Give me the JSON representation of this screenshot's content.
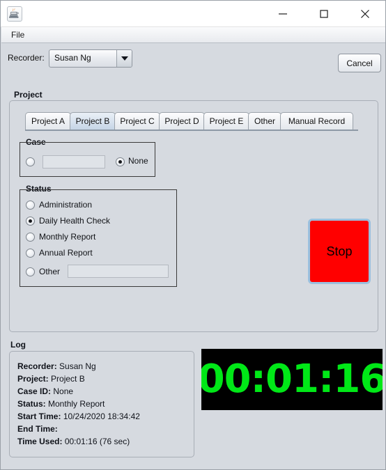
{
  "window": {
    "icon": "java-coffee-cup-icon",
    "title": "",
    "minimize_label": "—",
    "maximize_label": "☐",
    "close_label": "✕"
  },
  "menubar": {
    "items": [
      {
        "label": "File"
      }
    ]
  },
  "toolbar": {
    "recorder_label": "Recorder:",
    "recorder_value": "Susan Ng",
    "recorder_options": [
      "Susan Ng"
    ],
    "cancel_label": "Cancel"
  },
  "project_panel": {
    "title": "Project",
    "tabs": [
      {
        "label": "Project A",
        "selected": false
      },
      {
        "label": "Project B",
        "selected": true
      },
      {
        "label": "Project C",
        "selected": false
      },
      {
        "label": "Project D",
        "selected": false
      },
      {
        "label": "Project E",
        "selected": false
      },
      {
        "label": "Other",
        "selected": false
      },
      {
        "label": "Manual Record",
        "selected": false
      }
    ],
    "case_group": {
      "title": "Case",
      "case_id_radio_selected": false,
      "case_id_value": "",
      "none_label": "None",
      "none_selected": true
    },
    "status_group": {
      "title": "Status",
      "options": [
        {
          "label": "Administration",
          "selected": false
        },
        {
          "label": "Daily Health Check",
          "selected": true
        },
        {
          "label": "Monthly Report",
          "selected": false
        },
        {
          "label": "Annual Report",
          "selected": false
        },
        {
          "label": "Other",
          "selected": false
        }
      ],
      "other_value": ""
    },
    "stop_label": "Stop",
    "stop_color": "#ff0000"
  },
  "log": {
    "title": "Log",
    "entries": [
      {
        "key": "Recorder:",
        "value": "Susan Ng"
      },
      {
        "key": "Project:",
        "value": "Project B"
      },
      {
        "key": "Case ID:",
        "value": "None"
      },
      {
        "key": "Status:",
        "value": "Monthly Report"
      },
      {
        "key": "Start Time:",
        "value": "10/24/2020 18:34:42"
      },
      {
        "key": "End Time:",
        "value": ""
      },
      {
        "key": "Time Used:",
        "value": "00:01:16 (76 sec)"
      }
    ]
  },
  "timer": {
    "value": "00:01:16",
    "text_color": "#00e817",
    "background_color": "#000000"
  }
}
